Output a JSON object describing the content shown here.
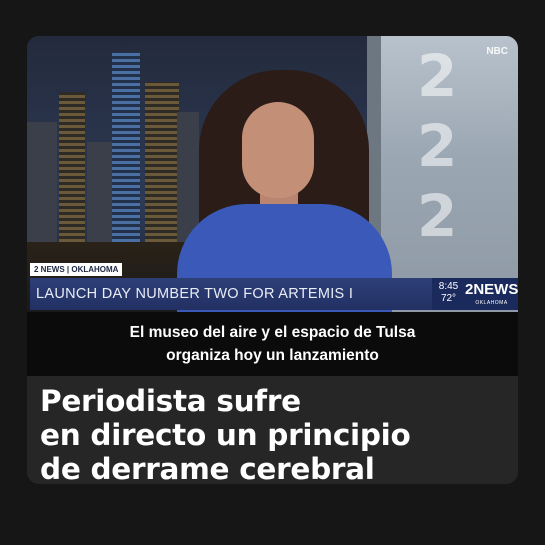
{
  "broadcast": {
    "network_logo": "NBC",
    "tag": "2 NEWS | OKLAHOMA",
    "ticker": "LAUNCH DAY NUMBER TWO FOR ARTEMIS I",
    "time": "8:45",
    "temperature": "72°",
    "brand_main": "2NEWS",
    "brand_sub": "OKLAHOMA"
  },
  "subtitle": {
    "line1": "El museo del aire y el espacio de Tulsa",
    "line2": "organiza hoy un lanzamiento"
  },
  "headline": {
    "line1": "Periodista sufre",
    "line2": "en directo un principio",
    "line3": "de derrame cerebral"
  },
  "colors": {
    "page_bg": "#161616",
    "ticker_bg": "#2e3f78",
    "subtitle_bg": "#0b0b0b"
  }
}
